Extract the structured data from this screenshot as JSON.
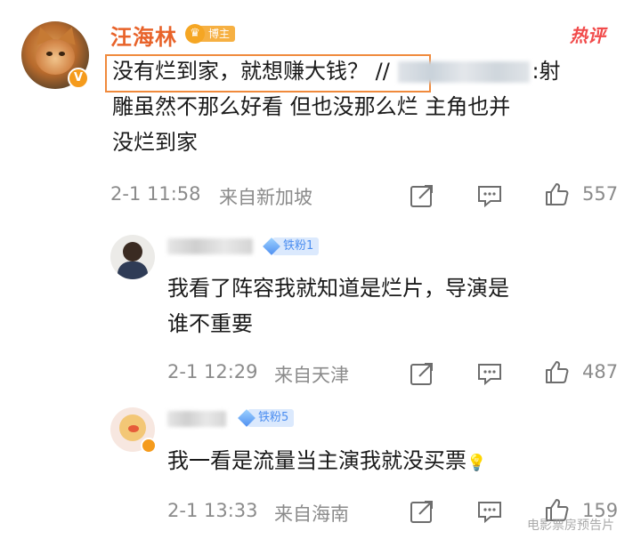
{
  "main_comment": {
    "username": "汪海林",
    "badge_label": "博主",
    "hot_tag": "热评",
    "line1_highlight": "没有烂到家，就想赚大钱？",
    "line1_prefix": "//",
    "line1_suffix": ":射",
    "line2": "雕虽然不那么好看 但也没那么烂 主角也并",
    "line3": "没烂到家",
    "time": "2-1 11:58",
    "location": "来自新加坡",
    "likes": "557"
  },
  "replies": [
    {
      "fan_badge": "铁粉1",
      "line1": "我看了阵容我就知道是烂片，导演是",
      "line2": "谁不重要",
      "time": "2-1 12:29",
      "location": "来自天津",
      "likes": "487"
    },
    {
      "fan_badge": "铁粉5",
      "line1": "我一看是流量当主演我就没买票",
      "emoji": "💡",
      "time": "2-1 13:33",
      "location": "来自海南",
      "likes": "159"
    }
  ],
  "watermark": "电影票房预告片",
  "colors": {
    "username": "#e8632a",
    "highlight_border": "#f08a3c",
    "hot_tag": "#f14b4b",
    "meta_text": "#8b8b8b",
    "fan_badge_bg": "#dbe9fd"
  },
  "icons": {
    "share": "share-icon",
    "comment": "comment-icon",
    "like": "thumbs-up-icon"
  }
}
